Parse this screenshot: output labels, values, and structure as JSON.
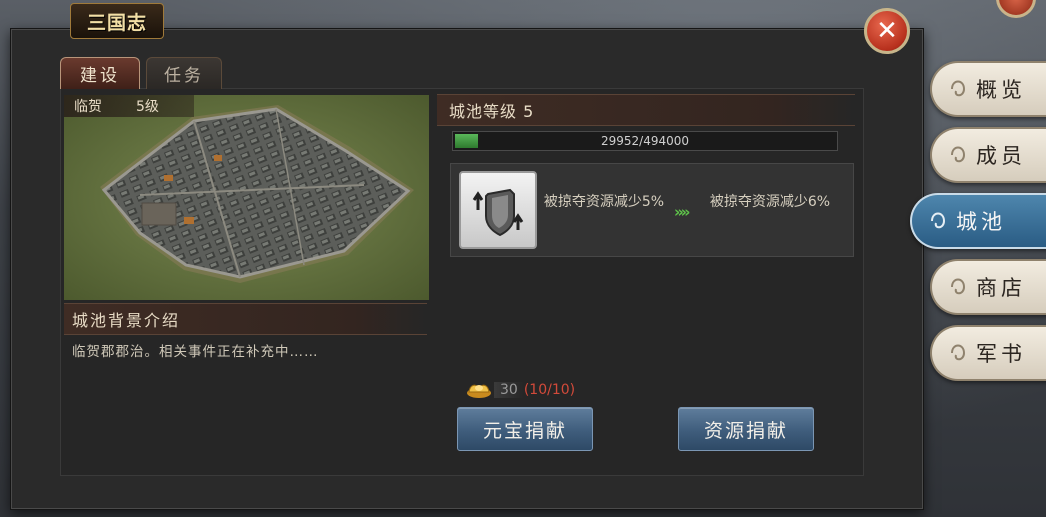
{
  "logo": {
    "text": "三国志"
  },
  "tabs": [
    {
      "label": "建设",
      "active": true
    },
    {
      "label": "任务",
      "active": false
    }
  ],
  "city": {
    "name": "临贺",
    "level_badge": "5级"
  },
  "background": {
    "header": "城池背景介绍",
    "text": "临贺郡郡治。相关事件正在补充中……"
  },
  "level": {
    "header": "城池等级 5",
    "progress_text": "29952/494000",
    "progress_fraction": 0.0606
  },
  "effect": {
    "icon": "shield-up-icon",
    "current": "被掠夺资源减少5%",
    "next": "被掠夺资源减少6%",
    "arrow": "»»"
  },
  "cost": {
    "amount": "30",
    "count": "(10/10)",
    "icon": "ingot-icon"
  },
  "actions": {
    "ingot_donate": "元宝捐献",
    "resource_donate": "资源捐献"
  },
  "side_nav": [
    {
      "label": "概览",
      "active": false
    },
    {
      "label": "成员",
      "active": false
    },
    {
      "label": "城池",
      "active": true
    },
    {
      "label": "商店",
      "active": false
    },
    {
      "label": "军书",
      "active": false
    }
  ],
  "colors": {
    "accent_red": "#d24a3a",
    "progress_green": "#4caf50",
    "button_blue": "#3f5d7c",
    "active_tab_blue": "#2a5c84"
  }
}
